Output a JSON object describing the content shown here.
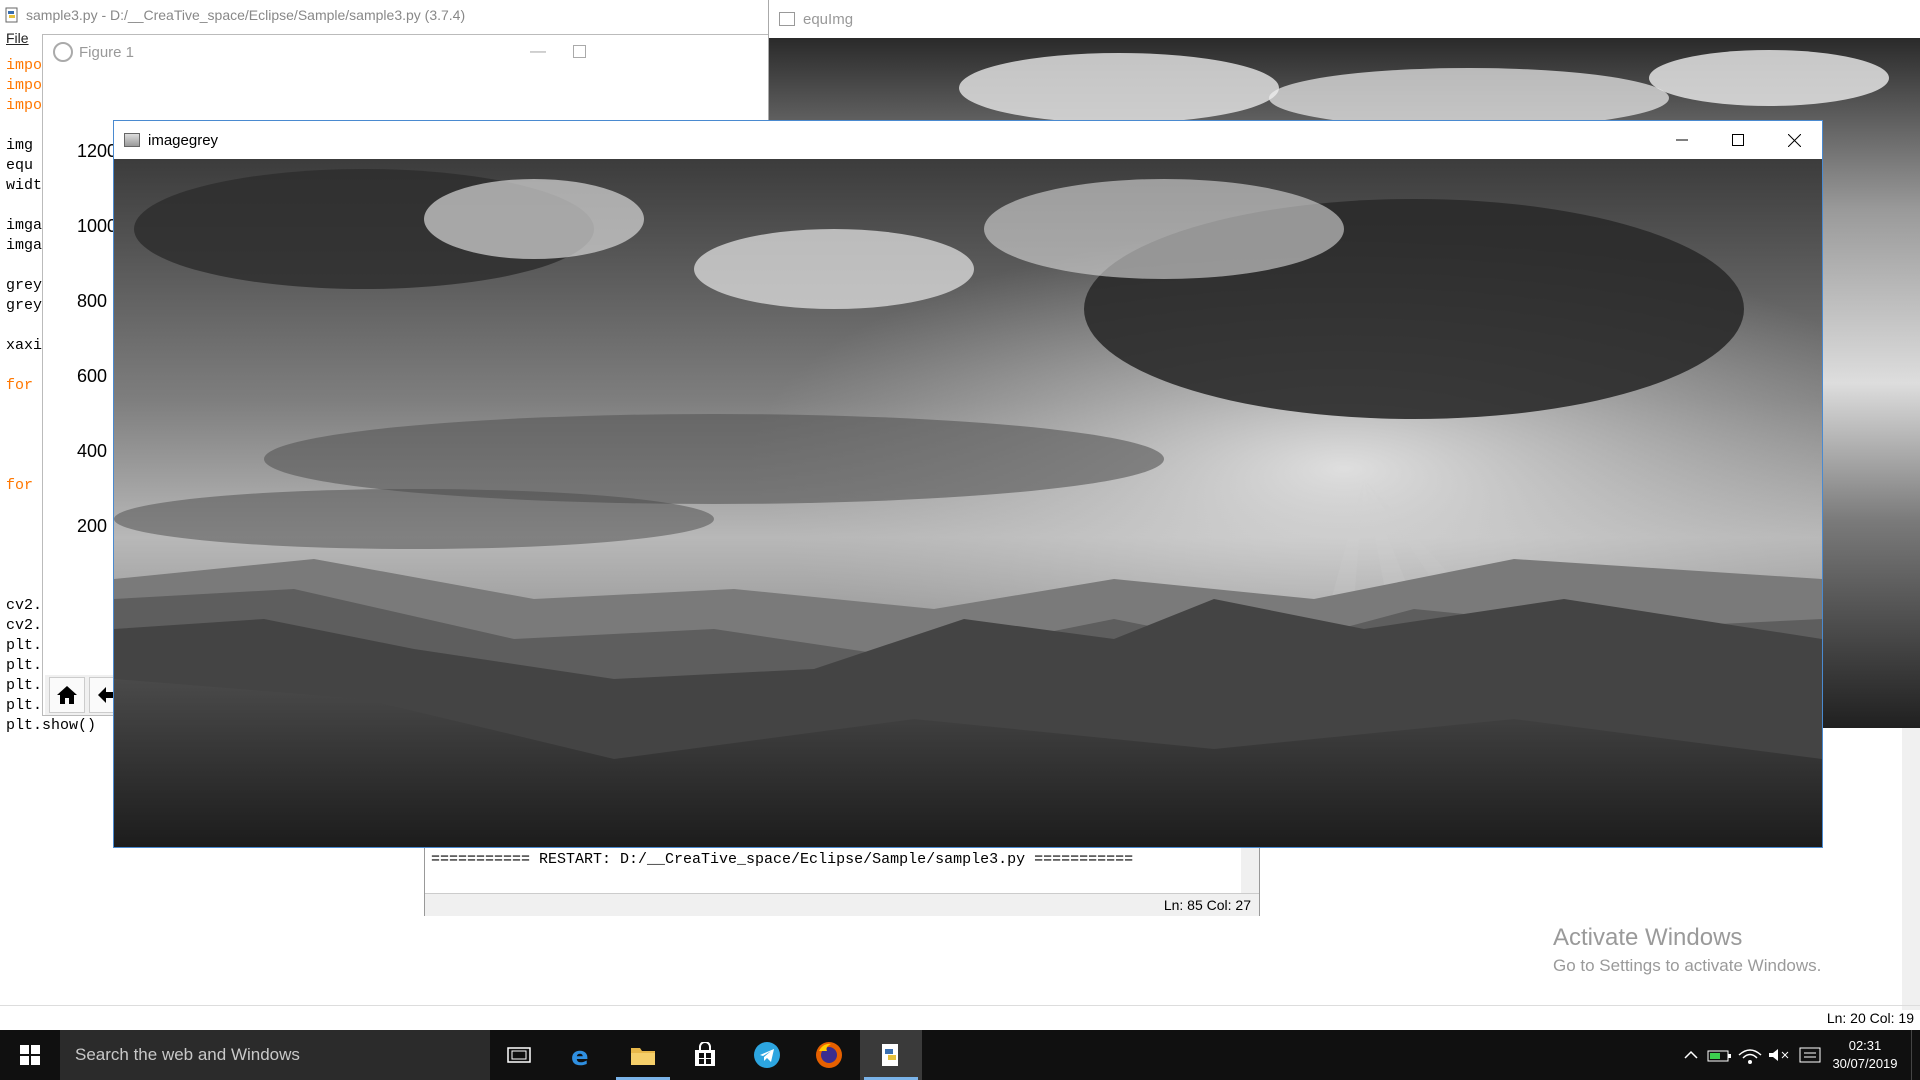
{
  "idle": {
    "title": "sample3.py - D:/__CreaTive_space/Eclipse/Sample/sample3.py (3.7.4)",
    "menu_file": "File",
    "code_lines": [
      {
        "text": "impo",
        "kw": true
      },
      {
        "text": "impo",
        "kw": true
      },
      {
        "text": "impo",
        "kw": true
      },
      {
        "text": "",
        "kw": false
      },
      {
        "text": "img",
        "kw": false
      },
      {
        "text": "equ",
        "kw": false
      },
      {
        "text": "widt",
        "kw": false
      },
      {
        "text": "",
        "kw": false
      },
      {
        "text": "imga",
        "kw": false
      },
      {
        "text": "imga",
        "kw": false
      },
      {
        "text": "",
        "kw": false
      },
      {
        "text": "grey",
        "kw": false
      },
      {
        "text": "grey",
        "kw": false
      },
      {
        "text": "",
        "kw": false
      },
      {
        "text": "xaxi",
        "kw": false
      },
      {
        "text": "",
        "kw": false
      },
      {
        "text": "for",
        "kw": true
      },
      {
        "text": "",
        "kw": false
      },
      {
        "text": "",
        "kw": false
      },
      {
        "text": "",
        "kw": false
      },
      {
        "text": "",
        "kw": false
      },
      {
        "text": "for",
        "kw": true
      },
      {
        "text": "",
        "kw": false
      },
      {
        "text": "",
        "kw": false
      },
      {
        "text": "",
        "kw": false
      },
      {
        "text": "",
        "kw": false
      },
      {
        "text": "",
        "kw": false
      },
      {
        "text": "cv2.",
        "kw": false
      },
      {
        "text": "cv2.",
        "kw": false
      },
      {
        "text": "plt.",
        "kw": false
      },
      {
        "text": "plt.",
        "kw": false
      },
      {
        "text": "plt.",
        "kw": false
      },
      {
        "text": "plt.",
        "kw": false
      },
      {
        "text": "plt.show()",
        "kw": false
      }
    ],
    "status": "Ln: 20   Col: 19"
  },
  "figure": {
    "title": "Figure 1",
    "yticks": [
      "1200",
      "1000",
      "800",
      "600",
      "400",
      "200"
    ]
  },
  "equimg": {
    "title": "equImg"
  },
  "imagegrey": {
    "title": "imagegrey"
  },
  "shell": {
    "restart_line": "=========== RESTART: D:/__CreaTive_space/Eclipse/Sample/sample3.py ===========",
    "status": "Ln: 85   Col: 27"
  },
  "watermark": {
    "title": "Activate Windows",
    "subtitle": "Go to Settings to activate Windows."
  },
  "taskbar": {
    "search_placeholder": "Search the web and Windows",
    "time": "02:31",
    "date": "30/07/2019"
  },
  "colors": {
    "keyword": "#ff7700",
    "window_border_active": "#4a8ad0",
    "taskbar": "#101010"
  }
}
